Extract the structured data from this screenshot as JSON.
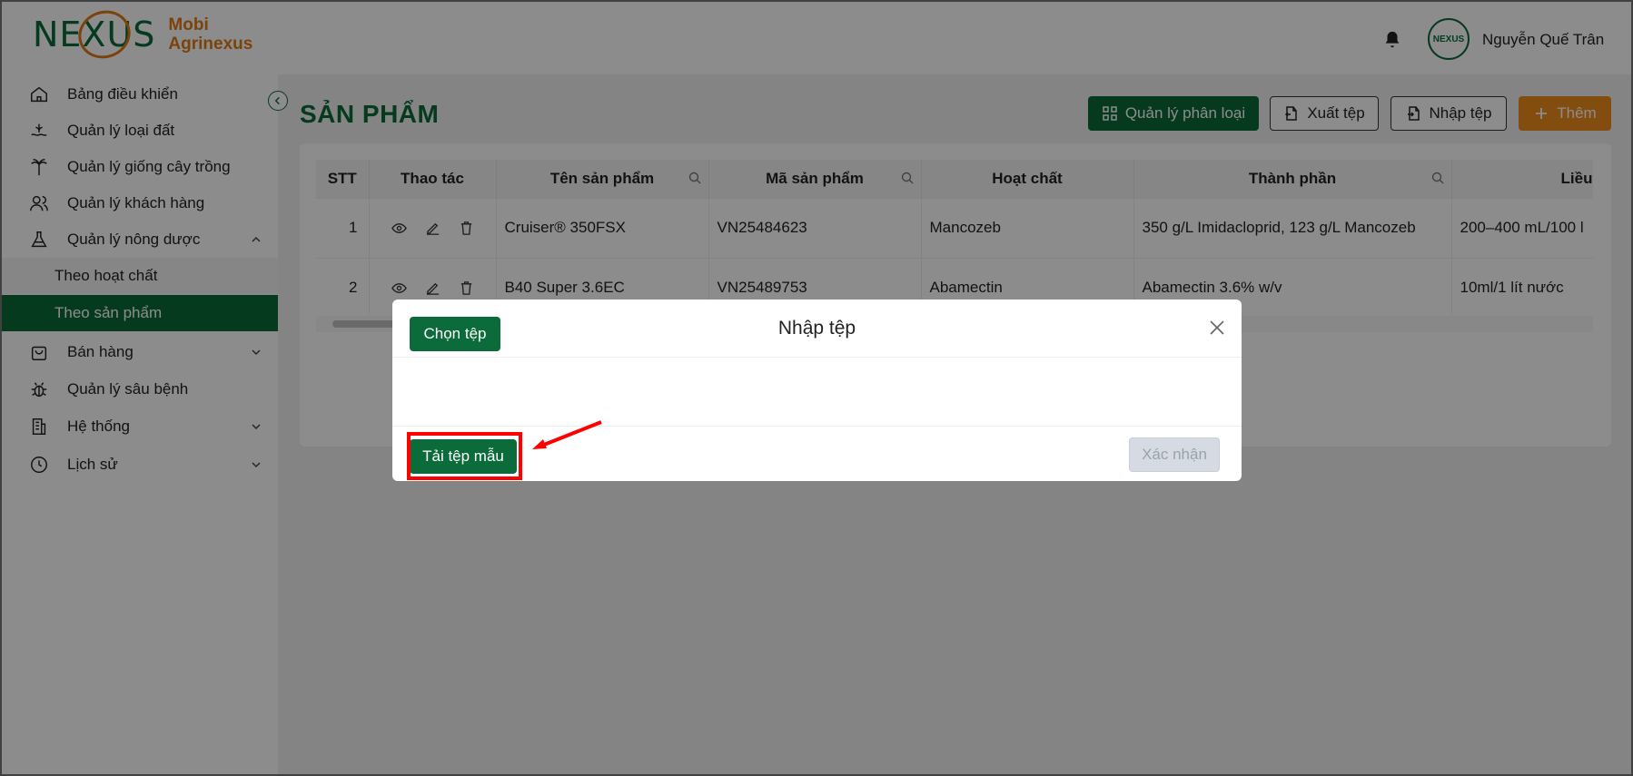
{
  "header": {
    "logo_mark": "NEXUS",
    "brand_line1": "Mobi",
    "brand_line2": "Agrinexus",
    "username": "Nguyễn Quế Trân",
    "avatar_text": "NEXUS"
  },
  "sidebar": {
    "items": [
      {
        "label": "Bảng điều khiển",
        "icon": "home-icon"
      },
      {
        "label": "Quản lý loại đất",
        "icon": "soil-icon"
      },
      {
        "label": "Quản lý giống cây trồng",
        "icon": "palm-tree-icon"
      },
      {
        "label": "Quản lý khách hàng",
        "icon": "users-icon"
      },
      {
        "label": "Quản lý nông dược",
        "icon": "flask-icon",
        "expanded": true
      }
    ],
    "sub_items": [
      {
        "label": "Theo hoạt chất",
        "active": false
      },
      {
        "label": "Theo sản phẩm",
        "active": true
      }
    ],
    "items_after": [
      {
        "label": "Bán hàng",
        "icon": "shopping-bag-icon"
      },
      {
        "label": "Quản lý sâu bệnh",
        "icon": "bug-icon"
      },
      {
        "label": "Hệ thống",
        "icon": "building-icon"
      },
      {
        "label": "Lịch sử",
        "icon": "clock-icon"
      }
    ]
  },
  "main": {
    "title": "SẢN PHẨM",
    "buttons": {
      "manage_category": "Quản lý phân loại",
      "export": "Xuất tệp",
      "import": "Nhập tệp",
      "add": "Thêm"
    },
    "table": {
      "columns": [
        "STT",
        "Thao tác",
        "Tên sản phẩm",
        "Mã sản phẩm",
        "Hoạt chất",
        "Thành phần",
        "Liều"
      ],
      "rows": [
        {
          "stt": "1",
          "name": "Cruiser® 350FSX",
          "code": "VN25484623",
          "active": "Mancozeb",
          "composition": "350 g/L Imidacloprid, 123 g/L Mancozeb",
          "dose": "200–400 mL/100 l"
        },
        {
          "stt": "2",
          "name": "B40 Super 3.6EC",
          "code": "VN25489753",
          "active": "Abamectin",
          "composition": "Abamectin 3.6% w/v",
          "dose": "10ml/1 lít nước"
        }
      ]
    }
  },
  "modal": {
    "title": "Nhập tệp",
    "choose_file": "Chọn tệp",
    "download_template": "Tải tệp mẫu",
    "confirm": "Xác nhận"
  },
  "colors": {
    "brand_green": "#0b6b3a",
    "brand_orange": "#e07b17",
    "annotation_red": "#ff0000"
  }
}
